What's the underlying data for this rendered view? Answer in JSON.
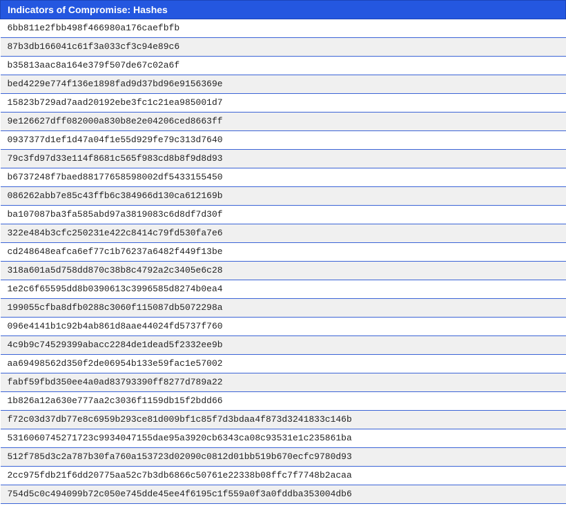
{
  "header": {
    "title": "Indicators of Compromise: Hashes"
  },
  "colors": {
    "header_bg": "#2457e0",
    "header_text": "#ffffff",
    "row_divider": "#3a63d6",
    "row_alt": "#f0f0f0"
  },
  "hashes": [
    "6bb811e2fbb498f466980a176caefbfb",
    "87b3db166041c61f3a033cf3c94e89c6",
    "b35813aac8a164e379f507de67c02a6f",
    "bed4229e774f136e1898fad9d37bd96e9156369e",
    "15823b729ad7aad20192ebe3fc1c21ea985001d7",
    "9e126627dff082000a830b8e2e04206ced8663ff",
    "0937377d1ef1d47a04f1e55d929fe79c313d7640",
    "79c3fd97d33e114f8681c565f983cd8b8f9d8d93",
    "b6737248f7baed88177658598002df5433155450",
    "086262abb7e85c43ffb6c384966d130ca612169b",
    "ba107087ba3fa585abd97a3819083c6d8df7d30f",
    "322e484b3cfc250231e422c8414c79fd530fa7e6",
    "cd248648eafca6ef77c1b76237a6482f449f13be",
    "318a601a5d758dd870c38b8c4792a2c3405e6c28",
    "1e2c6f65595dd8b0390613c3996585d8274b0ea4",
    "199055cfba8dfb0288c3060f115087db5072298a",
    "096e4141b1c92b4ab861d8aae44024fd5737f760",
    "4c9b9c74529399abacc2284de1dead5f2332ee9b",
    "aa69498562d350f2de06954b133e59fac1e57002",
    "fabf59fbd350ee4a0ad83793390ff8277d789a22",
    "1b826a12a630e777aa2c3036f1159db15f2bdd66",
    "f72c03d37db77e8c6959b293ce81d009bf1c85f7d3bdaa4f873d3241833c146b",
    "5316060745271723c9934047155dae95a3920cb6343ca08c93531e1c235861ba",
    "512f785d3c2a787b30fa760a153723d02090c0812d01bb519b670ecfc9780d93",
    "2cc975fdb21f6dd20775aa52c7b3db6866c50761e22338b08ffc7f7748b2acaa",
    "754d5c0c494099b72c050e745dde45ee4f6195c1f559a0f3a0fddba353004db6"
  ]
}
